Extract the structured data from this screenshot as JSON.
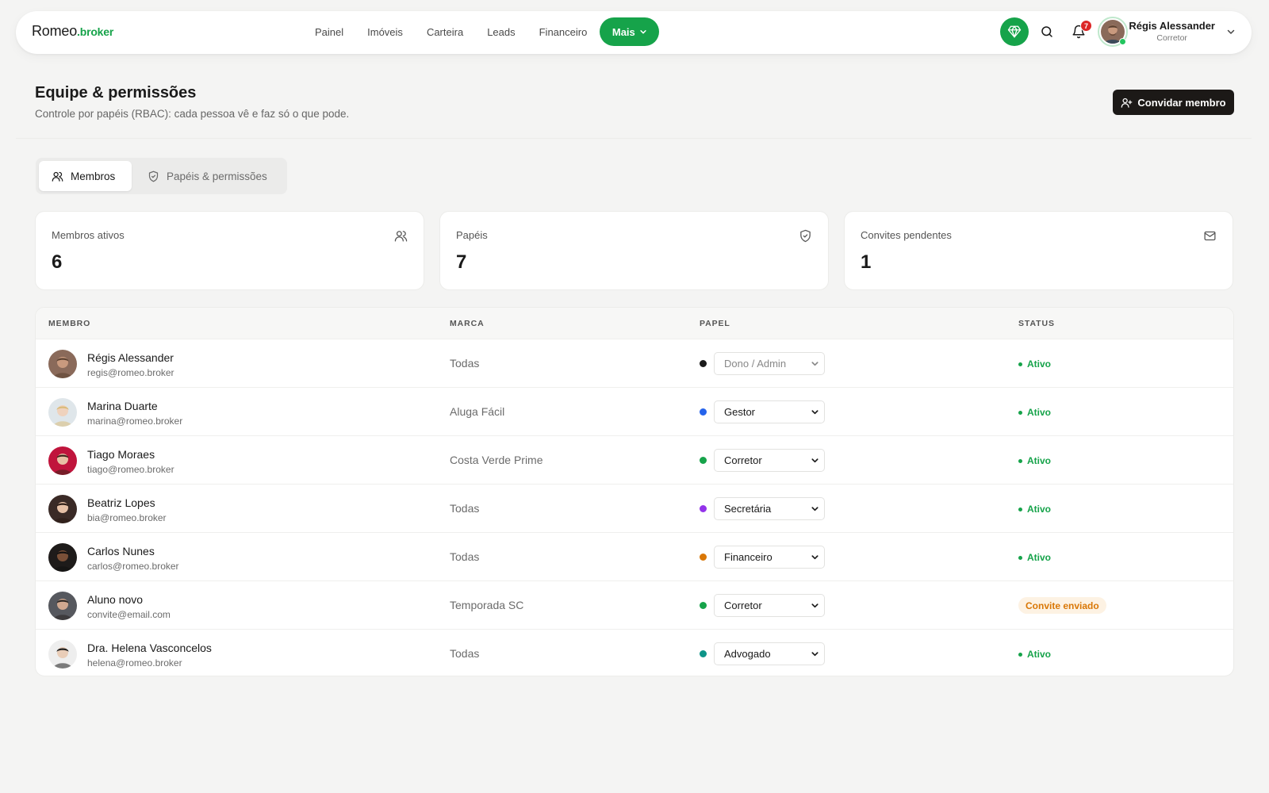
{
  "logo": {
    "part1": "Romeo",
    "part2": ".broker"
  },
  "nav": {
    "items": [
      "Painel",
      "Imóveis",
      "Carteira",
      "Leads",
      "Financeiro"
    ],
    "more_label": "Mais"
  },
  "notifications": {
    "count": "7"
  },
  "user": {
    "name": "Régis Alessander",
    "role": "Corretor"
  },
  "page": {
    "title": "Equipe & permissões",
    "subtitle": "Controle por papéis (RBAC): cada pessoa vê e faz só o que pode.",
    "invite_button": "Convidar membro"
  },
  "tabs": [
    {
      "label": "Membros",
      "icon": "users-icon",
      "active": true
    },
    {
      "label": "Papéis & permissões",
      "icon": "shield-icon",
      "active": false
    }
  ],
  "stats": [
    {
      "label": "Membros ativos",
      "value": "6",
      "icon": "users-icon"
    },
    {
      "label": "Papéis",
      "value": "7",
      "icon": "shield-icon"
    },
    {
      "label": "Convites pendentes",
      "value": "1",
      "icon": "mail-icon"
    }
  ],
  "table": {
    "headers": [
      "MEMBRO",
      "MARCA",
      "PAPEL",
      "STATUS"
    ],
    "rows": [
      {
        "name": "Régis Alessander",
        "email": "regis@romeo.broker",
        "brand": "Todas",
        "role": "Dono / Admin",
        "role_color": "#1a1a1a",
        "status": "Ativo",
        "status_type": "active",
        "role_editable": false,
        "avatar_bg": "#8a6a5a",
        "avatar_skin": "#c99a7e",
        "avatar_hair": "#5a4030"
      },
      {
        "name": "Marina Duarte",
        "email": "marina@romeo.broker",
        "brand": "Aluga Fácil",
        "role": "Gestor",
        "role_color": "#2563eb",
        "status": "Ativo",
        "status_type": "active",
        "role_editable": true,
        "avatar_bg": "#dfe6ea",
        "avatar_skin": "#efd2bd",
        "avatar_hair": "#d9bb7a"
      },
      {
        "name": "Tiago Moraes",
        "email": "tiago@romeo.broker",
        "brand": "Costa Verde Prime",
        "role": "Corretor",
        "role_color": "#16a34a",
        "status": "Ativo",
        "status_type": "active",
        "role_editable": true,
        "avatar_bg": "#c0143c",
        "avatar_skin": "#e8c0a4",
        "avatar_hair": "#3a2418"
      },
      {
        "name": "Beatriz Lopes",
        "email": "bia@romeo.broker",
        "brand": "Todas",
        "role": "Secretária",
        "role_color": "#9333ea",
        "status": "Ativo",
        "status_type": "active",
        "role_editable": true,
        "avatar_bg": "#3a2a26",
        "avatar_skin": "#e6c0a6",
        "avatar_hair": "#2a1a14"
      },
      {
        "name": "Carlos Nunes",
        "email": "carlos@romeo.broker",
        "brand": "Todas",
        "role": "Financeiro",
        "role_color": "#d97706",
        "status": "Ativo",
        "status_type": "active",
        "role_editable": true,
        "avatar_bg": "#1e1b1a",
        "avatar_skin": "#7a5038",
        "avatar_hair": "#111111"
      },
      {
        "name": "Aluno novo",
        "email": "convite@email.com",
        "brand": "Temporada SC",
        "role": "Corretor",
        "role_color": "#16a34a",
        "status": "Convite enviado",
        "status_type": "invite",
        "role_editable": true,
        "avatar_bg": "#56585e",
        "avatar_skin": "#d0a890",
        "avatar_hair": "#2a2522"
      },
      {
        "name": "Dra. Helena Vasconcelos",
        "email": "helena@romeo.broker",
        "brand": "Todas",
        "role": "Advogado",
        "role_color": "#0d9488",
        "status": "Ativo",
        "status_type": "active",
        "role_editable": true,
        "avatar_bg": "#eeeeee",
        "avatar_skin": "#e9cdb8",
        "avatar_hair": "#1b1b1b"
      }
    ]
  },
  "colors": {
    "brand_green": "#16a34a",
    "dark_button": "#1c1917",
    "badge_red": "#dc2626",
    "invite_text": "#d97706",
    "invite_bg": "#fdf2e3"
  }
}
